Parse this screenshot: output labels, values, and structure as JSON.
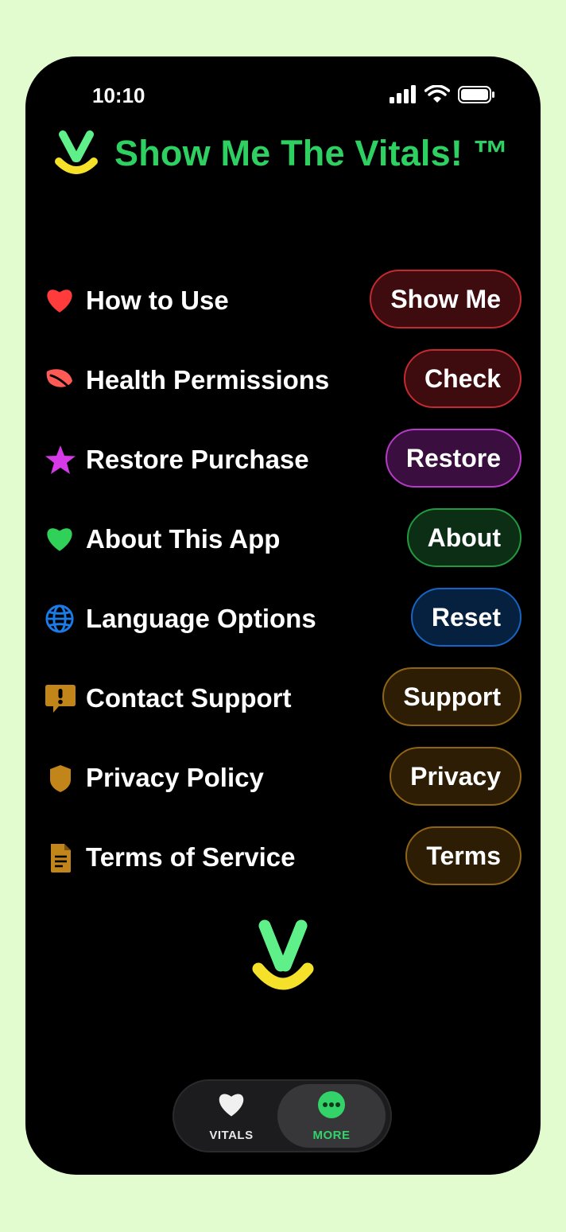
{
  "status_bar": {
    "time": "10:10"
  },
  "header": {
    "title": "Show Me The Vitals! ™"
  },
  "menu": [
    {
      "label": "How to Use",
      "button": "Show Me",
      "icon": "heart-icon",
      "color": "#ff3b3b",
      "btn_bg": "#3e0b0e",
      "btn_border": "#c42a30"
    },
    {
      "label": "Health Permissions",
      "button": "Check",
      "icon": "leaf-icon",
      "color": "#ff5a55",
      "btn_bg": "#3e0b0e",
      "btn_border": "#c42a30"
    },
    {
      "label": "Restore Purchase",
      "button": "Restore",
      "icon": "star-icon",
      "color": "#d63ae8",
      "btn_bg": "#3a0e3f",
      "btn_border": "#b83ac8"
    },
    {
      "label": "About This App",
      "button": "About",
      "icon": "heart-icon",
      "color": "#30d158",
      "btn_bg": "#0b2e14",
      "btn_border": "#239a3f"
    },
    {
      "label": "Language Options",
      "button": "Reset",
      "icon": "globe-icon",
      "color": "#1a7ce8",
      "btn_bg": "#05213f",
      "btn_border": "#1764c2"
    },
    {
      "label": "Contact Support",
      "button": "Support",
      "icon": "exclamation-bubble-icon",
      "color": "#c2851a",
      "btn_bg": "#2e1d05",
      "btn_border": "#8f6417"
    },
    {
      "label": "Privacy Policy",
      "button": "Privacy",
      "icon": "shield-icon",
      "color": "#c2851a",
      "btn_bg": "#2e1d05",
      "btn_border": "#8f6417"
    },
    {
      "label": "Terms of Service",
      "button": "Terms",
      "icon": "document-icon",
      "color": "#c2851a",
      "btn_bg": "#2e1d05",
      "btn_border": "#8f6417"
    }
  ],
  "tabs": [
    {
      "label": "VITALS",
      "icon": "heart-icon",
      "selected": false
    },
    {
      "label": "MORE",
      "icon": "ellipsis-circle-icon",
      "selected": true
    }
  ]
}
